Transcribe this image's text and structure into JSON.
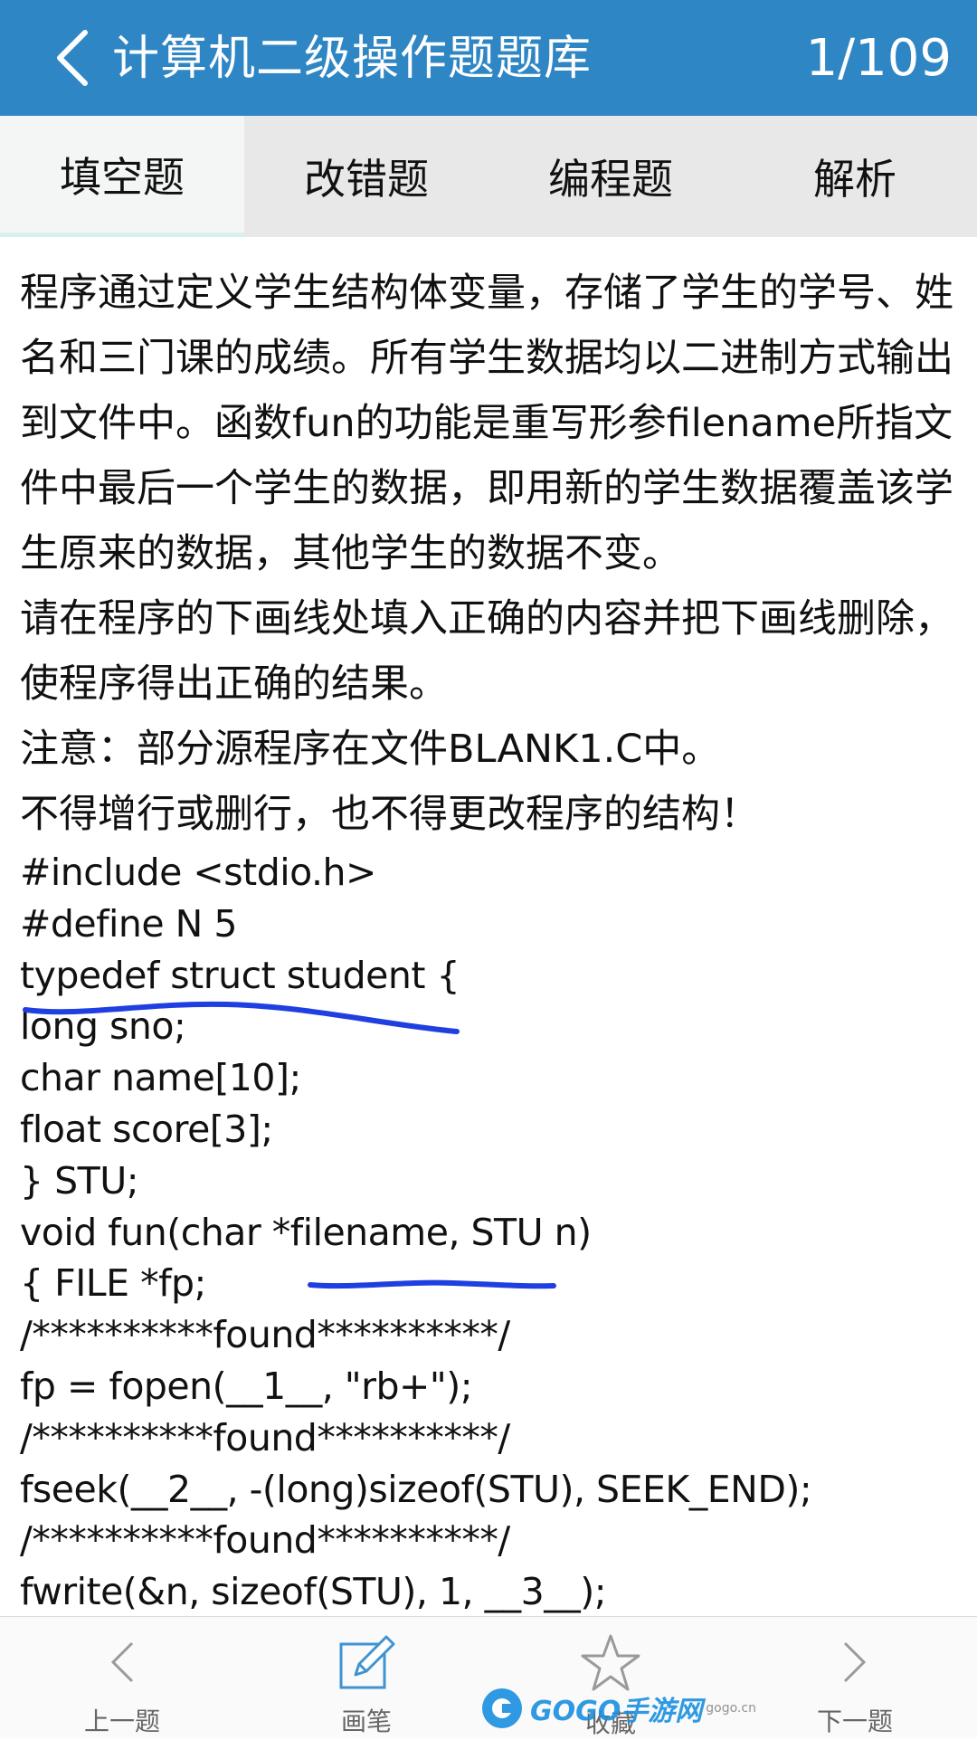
{
  "header": {
    "title": "计算机二级操作题题库",
    "counter": "1/109"
  },
  "tabs": [
    {
      "label": "填空题",
      "active": true
    },
    {
      "label": "改错题",
      "active": false
    },
    {
      "label": "编程题",
      "active": false
    },
    {
      "label": "解析",
      "active": false
    }
  ],
  "content": {
    "paragraphs": [
      "程序通过定义学生结构体变量，存储了学生的学号、姓名和三门课的成绩。所有学生数据均以二进制方式输出到文件中。函数fun的功能是重写形参filename所指文件中最后一个学生的数据，即用新的学生数据覆盖该学生原来的数据，其他学生的数据不变。",
      "请在程序的下画线处填入正确的内容并把下画线删除，使程序得出正确的结果。",
      "注意：部分源程序在文件BLANK1.C中。",
      "不得增行或删行，也不得更改程序的结构！"
    ],
    "code": [
      "#include <stdio.h>",
      "#define N 5",
      "typedef struct student {",
      "long sno;",
      "char name[10];",
      "float score[3];",
      "} STU;",
      "void fun(char *filename, STU n)",
      "{ FILE *fp;",
      "/**********found**********/",
      "fp = fopen(__1__, \"rb+\");",
      "/**********found**********/",
      "fseek(__2__, -(long)sizeof(STU), SEEK_END);",
      "/**********found**********/",
      "fwrite(&n, sizeof(STU), 1, __3__);"
    ]
  },
  "bottom_nav": [
    {
      "label": "上一题",
      "icon": "chevron-left-icon"
    },
    {
      "label": "画笔",
      "icon": "pen-icon"
    },
    {
      "label": "收藏",
      "icon": "star-icon"
    },
    {
      "label": "下一题",
      "icon": "chevron-right-icon"
    }
  ],
  "watermark": {
    "text": "GOGO手游网",
    "sub": "gogo.cn"
  },
  "colors": {
    "header_bg": "#2f86c4",
    "scribble": "#1f3fe0",
    "watermark": "#1a8fe0"
  }
}
